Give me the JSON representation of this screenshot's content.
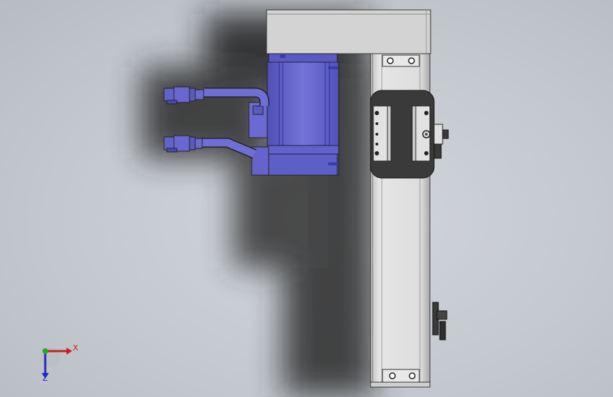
{
  "triad": {
    "x_label": "X",
    "z_label": "Z"
  },
  "colors": {
    "background": "#c6cbd1",
    "motor": "#6b6bd0",
    "motor_dark": "#4c4cb0",
    "rail": "#d4d4d4",
    "carriage": "#3a3a3a",
    "top_block": "#d2d2d2"
  },
  "model": {
    "components": [
      "linear-actuator-rail",
      "servo-motor",
      "carriage",
      "motor-cables",
      "connectors",
      "top-mount-block"
    ]
  }
}
